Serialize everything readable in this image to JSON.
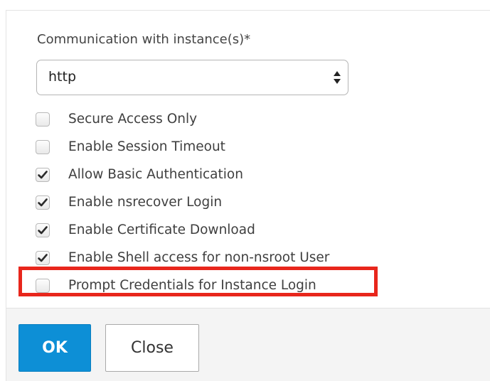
{
  "form": {
    "communication_label": "Communication with instance(s)*",
    "communication_value": "http"
  },
  "options": [
    {
      "label": "Secure Access Only",
      "checked": false
    },
    {
      "label": "Enable Session Timeout",
      "checked": false
    },
    {
      "label": "Allow Basic Authentication",
      "checked": true
    },
    {
      "label": "Enable nsrecover Login",
      "checked": true
    },
    {
      "label": "Enable Certificate Download",
      "checked": true
    },
    {
      "label": "Enable Shell access for non-nsroot User",
      "checked": true
    },
    {
      "label": "Prompt Credentials for Instance Login",
      "checked": false
    }
  ],
  "highlight": {
    "target": "Prompt Credentials for Instance Login",
    "color": "#e8261c"
  },
  "buttons": {
    "ok_label": "OK",
    "close_label": "Close"
  },
  "colors": {
    "primary": "#0d8fd6",
    "highlight": "#e8261c"
  }
}
